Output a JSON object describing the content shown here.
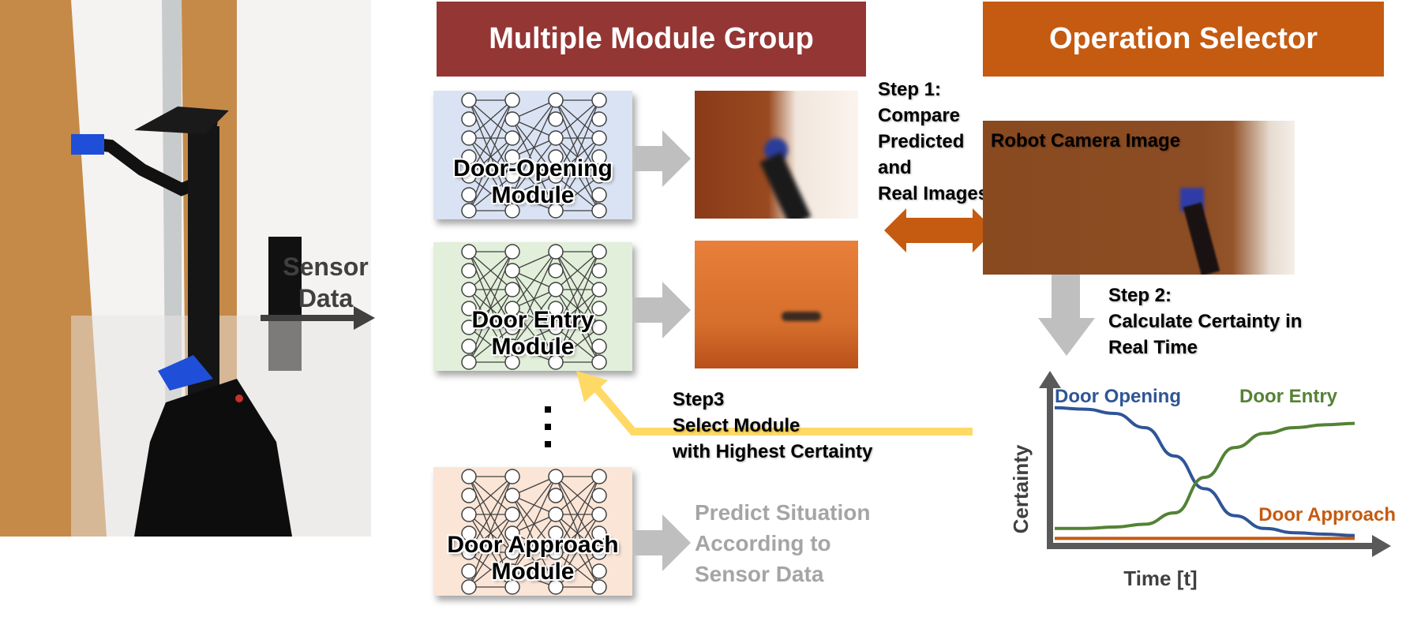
{
  "headers": {
    "module_group": "Multiple Module Group",
    "operation_selector": "Operation Selector"
  },
  "colors": {
    "module_group_header": "#943634",
    "operation_selector_header": "#C55A11",
    "door_opening_box": "#DAE3F3",
    "door_entry_box": "#E2EFDA",
    "door_approach_box": "#FBE5D6",
    "arrow_gray": "#BFBFBF",
    "arrow_dark": "#404040",
    "step3_arrow": "#FFD966",
    "double_arrow": "#C55A11",
    "series_door_opening": "#2F5597",
    "series_door_entry": "#548235",
    "series_door_approach": "#C55A11"
  },
  "sensor_label": [
    "Sensor",
    "Data"
  ],
  "modules": [
    {
      "name": "Door-Opening",
      "suffix": "Module"
    },
    {
      "name": "Door Entry",
      "suffix": "Module"
    },
    {
      "name": "Door Approach",
      "suffix": "Module"
    }
  ],
  "ellipsis": "⋮",
  "predict_text": [
    "Predict Situation",
    "According to",
    "Sensor Data"
  ],
  "step1": [
    "Step 1:",
    "Compare",
    "Predicted",
    "and",
    "Real Images"
  ],
  "robot_camera_label": "Robot Camera Image",
  "step2": [
    "Step 2:",
    "Calculate Certainty in",
    "Real Time"
  ],
  "step3": [
    "Step3",
    "Select Module",
    "with Highest Certainty"
  ],
  "chart_data": {
    "type": "line",
    "title": "",
    "xlabel": "Time [t]",
    "ylabel": "Certainty",
    "grid": false,
    "x": [
      0,
      0.1,
      0.2,
      0.3,
      0.4,
      0.5,
      0.6,
      0.7,
      0.8,
      0.9,
      1.0
    ],
    "xlim": [
      0,
      1
    ],
    "ylim": [
      0,
      1
    ],
    "series": [
      {
        "name": "Door Opening",
        "values": [
          0.94,
          0.93,
          0.9,
          0.8,
          0.6,
          0.37,
          0.18,
          0.09,
          0.06,
          0.05,
          0.04
        ]
      },
      {
        "name": "Door Entry",
        "values": [
          0.09,
          0.09,
          0.1,
          0.12,
          0.2,
          0.45,
          0.66,
          0.76,
          0.8,
          0.82,
          0.83
        ]
      },
      {
        "name": "Door Approach",
        "values": [
          0.02,
          0.02,
          0.02,
          0.02,
          0.02,
          0.02,
          0.02,
          0.02,
          0.02,
          0.02,
          0.02
        ]
      }
    ],
    "legend_placement": "inline-labels"
  }
}
